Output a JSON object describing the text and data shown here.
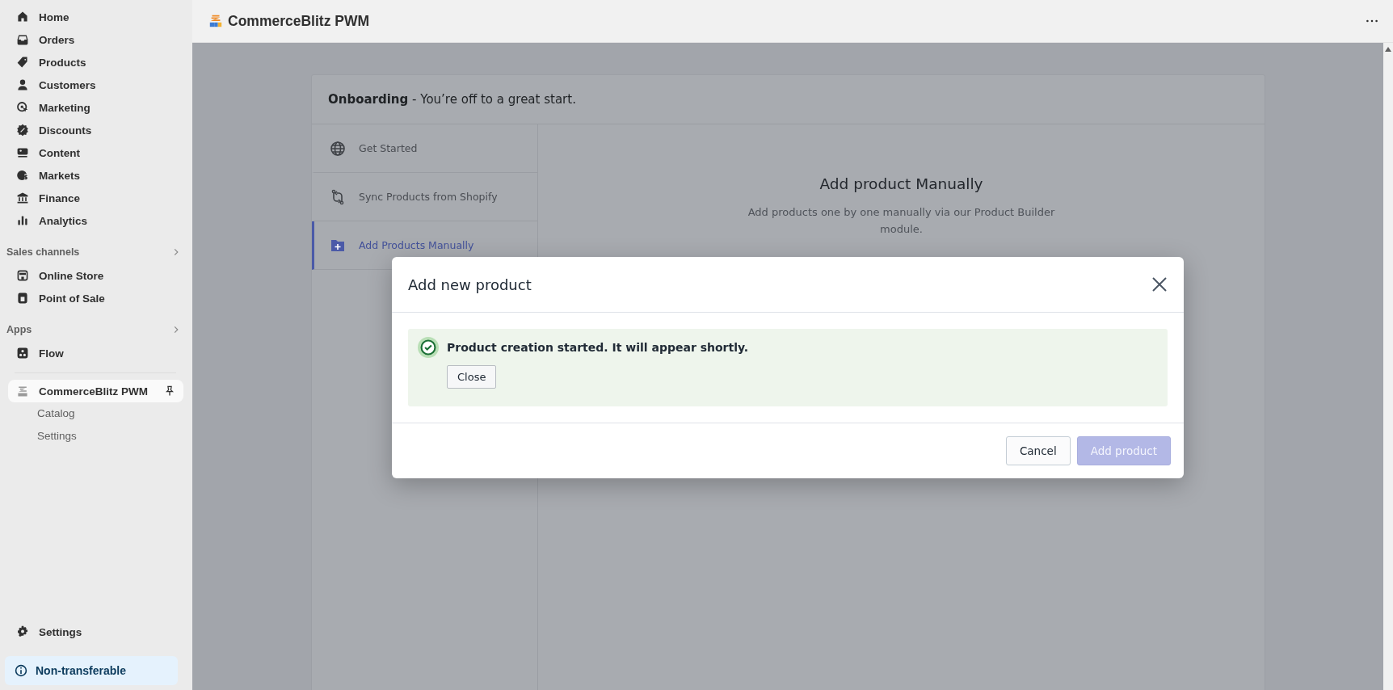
{
  "sidebar": {
    "nav_items": [
      {
        "label": "Home",
        "selected": false
      },
      {
        "label": "Orders",
        "selected": false
      },
      {
        "label": "Products",
        "selected": false
      },
      {
        "label": "Customers",
        "selected": false
      },
      {
        "label": "Marketing",
        "selected": false
      },
      {
        "label": "Discounts",
        "selected": false
      },
      {
        "label": "Content",
        "selected": false
      },
      {
        "label": "Markets",
        "selected": false
      },
      {
        "label": "Finance",
        "selected": false
      },
      {
        "label": "Analytics",
        "selected": false
      }
    ],
    "sections": [
      {
        "title": "Sales channels",
        "items": [
          {
            "label": "Online Store",
            "selected": false
          },
          {
            "label": "Point of Sale",
            "selected": false
          }
        ]
      },
      {
        "title": "Apps",
        "items": [
          {
            "label": "Flow",
            "selected": false
          }
        ]
      }
    ],
    "app": {
      "name": "CommerceBlitz PWM",
      "selected": true,
      "subitems": [
        "Catalog",
        "Settings"
      ]
    },
    "settings": "Settings",
    "notice": "Non-transferable"
  },
  "header": {
    "title": "CommerceBlitz PWM"
  },
  "onboarding": {
    "title": "**Onboarding** - You’re off to a great start.",
    "steps": [
      {
        "label": "Get Started",
        "selected": false
      },
      {
        "label": "Sync Products from Shopify",
        "selected": false
      },
      {
        "label": "Add Products Manually",
        "selected": true
      }
    ],
    "content": {
      "heading": "Add product Manually",
      "description": "Add products one by one manually via our Product Builder module."
    }
  },
  "modal": {
    "title": "Add new product",
    "alert": {
      "message": "Product creation started. It will appear shortly.",
      "button": "Close"
    },
    "buttons": [
      {
        "label": "Cancel",
        "kind": "secondary",
        "disabled": false
      },
      {
        "label": "Add product",
        "kind": "primary",
        "disabled": true
      }
    ]
  }
}
